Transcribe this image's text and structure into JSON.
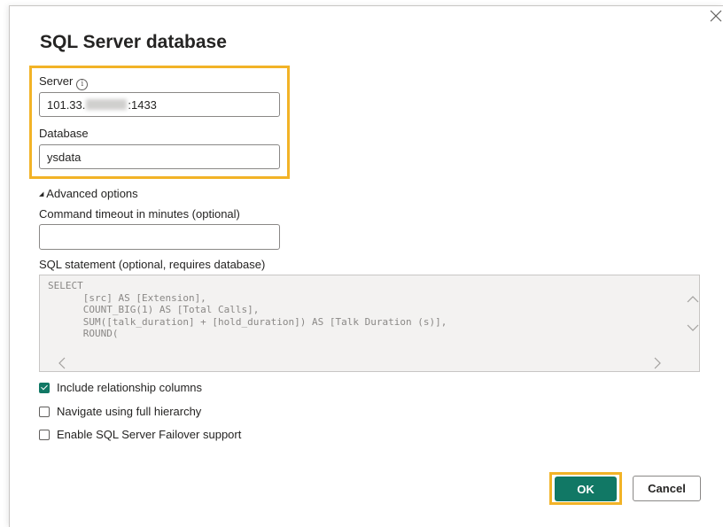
{
  "dialog": {
    "title": "SQL Server database",
    "close_icon": "close-icon",
    "highlight_color": "#f2b327"
  },
  "server": {
    "label": "Server",
    "info_icon": "info-icon",
    "info_glyph": "i",
    "value_prefix": "101.33.",
    "value_suffix": ":1433"
  },
  "database": {
    "label": "Database",
    "value": "ysdata"
  },
  "advanced": {
    "toggle_glyph": "◢",
    "label": "Advanced options",
    "timeout_label": "Command timeout in minutes (optional)",
    "timeout_value": "",
    "sql_label": "SQL statement (optional, requires database)",
    "sql_text": "SELECT\n      [src] AS [Extension],\n      COUNT_BIG(1) AS [Total Calls],\n      SUM([talk_duration] + [hold_duration]) AS [Talk Duration (s)],\n      ROUND("
  },
  "options": [
    {
      "label": "Include relationship columns",
      "checked": true
    },
    {
      "label": "Navigate using full hierarchy",
      "checked": false
    },
    {
      "label": "Enable SQL Server Failover support",
      "checked": false
    }
  ],
  "buttons": {
    "ok": "OK",
    "cancel": "Cancel",
    "ok_color": "#117865"
  },
  "scroll_icons": {
    "up": "chevron-up-icon",
    "down": "chevron-down-icon",
    "left": "chevron-left-icon",
    "right": "chevron-right-icon"
  }
}
